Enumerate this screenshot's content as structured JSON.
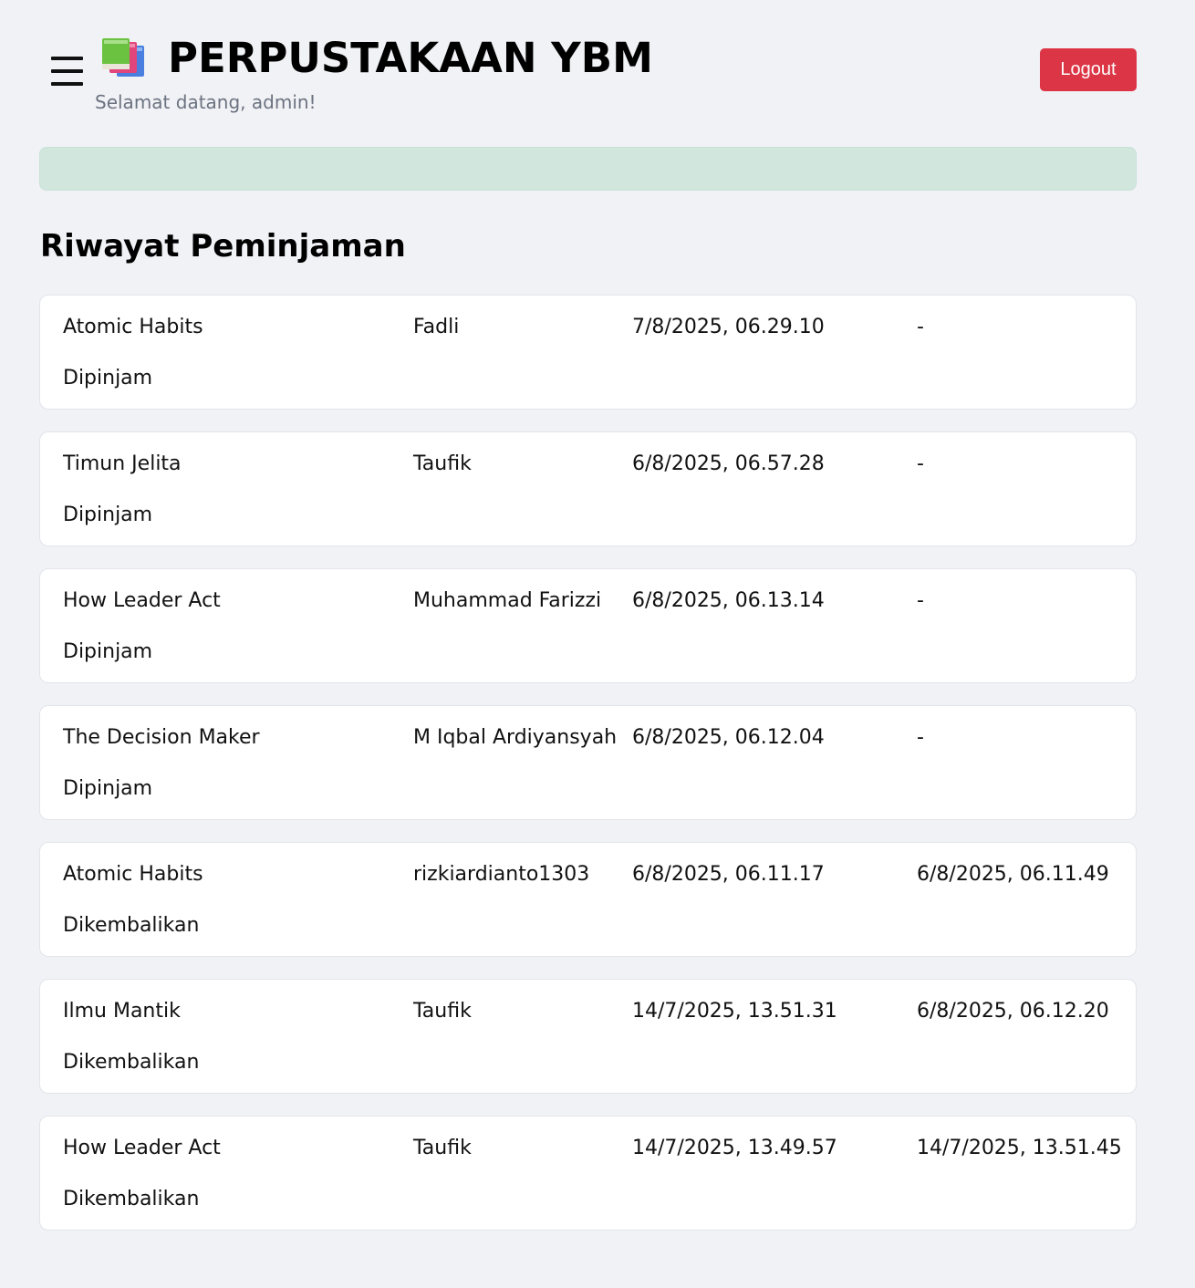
{
  "header": {
    "title": "PERPUSTAKAAN YBM",
    "welcome": "Selamat datang, admin!",
    "logout_label": "Logout",
    "logo_icon": "books-icon",
    "menu_icon": "hamburger-menu-icon"
  },
  "colors": {
    "background": "#f1f2f6",
    "logout": "#dc3545",
    "alert": "#d1e7dd"
  },
  "section": {
    "title": "Riwayat Peminjaman"
  },
  "loans": [
    {
      "book": "Atomic Habits",
      "borrower": "Fadli",
      "borrowed_at": "7/8/2025, 06.29.10",
      "returned_at": "-",
      "status": "Dipinjam"
    },
    {
      "book": "Timun Jelita",
      "borrower": "Taufik",
      "borrowed_at": "6/8/2025, 06.57.28",
      "returned_at": "-",
      "status": "Dipinjam"
    },
    {
      "book": "How Leader Act",
      "borrower": "Muhammad Farizzi",
      "borrowed_at": "6/8/2025, 06.13.14",
      "returned_at": "-",
      "status": "Dipinjam"
    },
    {
      "book": "The Decision Maker",
      "borrower": "M Iqbal Ardiyansyah",
      "borrowed_at": "6/8/2025, 06.12.04",
      "returned_at": "-",
      "status": "Dipinjam"
    },
    {
      "book": "Atomic Habits",
      "borrower": "rizkiardianto1303",
      "borrowed_at": "6/8/2025, 06.11.17",
      "returned_at": "6/8/2025, 06.11.49",
      "status": "Dikembalikan"
    },
    {
      "book": "Ilmu Mantik",
      "borrower": "Taufik",
      "borrowed_at": "14/7/2025, 13.51.31",
      "returned_at": "6/8/2025, 06.12.20",
      "status": "Dikembalikan"
    },
    {
      "book": "How Leader Act",
      "borrower": "Taufik",
      "borrowed_at": "14/7/2025, 13.49.57",
      "returned_at": "14/7/2025, 13.51.45",
      "status": "Dikembalikan"
    }
  ]
}
